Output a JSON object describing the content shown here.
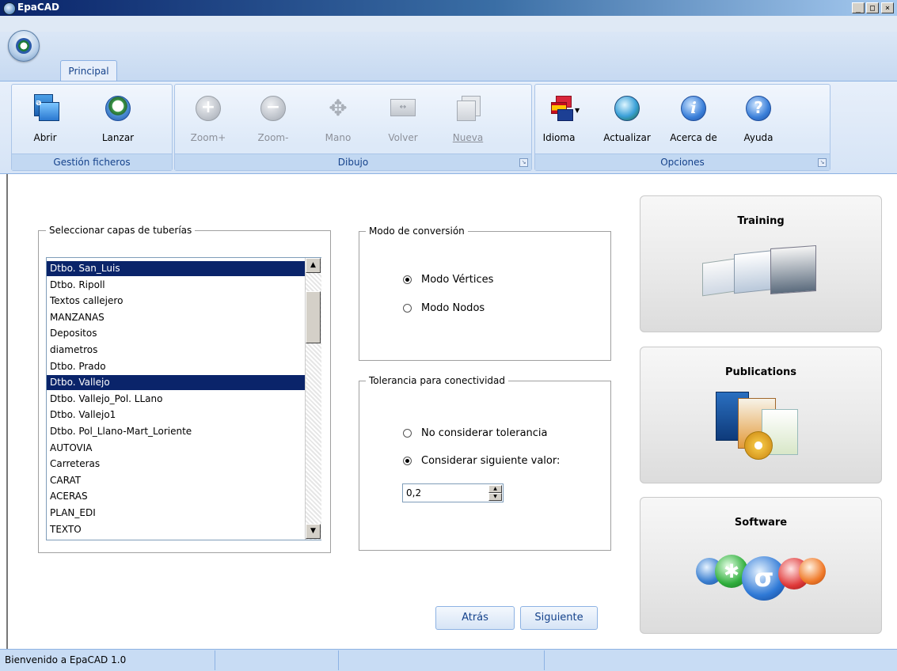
{
  "window": {
    "title": "EpaCAD",
    "min_label": "_",
    "max_label": "□",
    "close_label": "×"
  },
  "ribbon": {
    "tab": "Principal",
    "groups": [
      {
        "label": "Gestión ficheros",
        "tools": [
          {
            "label": "Abrir",
            "icon": "open-folder-icon"
          },
          {
            "label": "Lanzar",
            "icon": "launch-epa-icon"
          }
        ]
      },
      {
        "label": "Dibujo",
        "tools": [
          {
            "label": "Zoom+",
            "icon": "zoom-in-icon"
          },
          {
            "label": "Zoom-",
            "icon": "zoom-out-icon"
          },
          {
            "label": "Mano",
            "icon": "pan-hand-icon"
          },
          {
            "label": "Volver",
            "icon": "restore-view-icon"
          },
          {
            "label": "Nueva",
            "icon": "new-window-icon"
          }
        ]
      },
      {
        "label": "Opciones",
        "tools": [
          {
            "label": "Idioma",
            "icon": "language-flags-icon"
          },
          {
            "label": "Actualizar",
            "icon": "update-globe-icon"
          },
          {
            "label": "Acerca de",
            "icon": "info-icon"
          },
          {
            "label": "Ayuda",
            "icon": "help-icon"
          }
        ]
      }
    ]
  },
  "layers": {
    "legend": "Seleccionar capas  de tuberías",
    "items": [
      {
        "label": "Dtbo. San_Luis",
        "selected": true
      },
      {
        "label": "Dtbo. Ripoll",
        "selected": false
      },
      {
        "label": "Textos callejero",
        "selected": false
      },
      {
        "label": "MANZANAS",
        "selected": false
      },
      {
        "label": "Depositos",
        "selected": false
      },
      {
        "label": "diametros",
        "selected": false
      },
      {
        "label": "Dtbo. Prado",
        "selected": false
      },
      {
        "label": "Dtbo. Vallejo",
        "selected": true
      },
      {
        "label": "Dtbo. Vallejo_Pol. LLano",
        "selected": false
      },
      {
        "label": "Dtbo. Vallejo1",
        "selected": false
      },
      {
        "label": "Dtbo. Pol_Llano-Mart_Loriente",
        "selected": false
      },
      {
        "label": "AUTOVIA",
        "selected": false
      },
      {
        "label": "Carreteras",
        "selected": false
      },
      {
        "label": "CARAT",
        "selected": false
      },
      {
        "label": "ACERAS",
        "selected": false
      },
      {
        "label": "PLAN_EDI",
        "selected": false
      },
      {
        "label": "TEXTO",
        "selected": false
      }
    ]
  },
  "conversion": {
    "legend": "Modo de conversión",
    "option_vertices": "Modo Vértices",
    "option_nodes": "Modo Nodos",
    "selected": "Modo Vértices"
  },
  "tolerance": {
    "legend": "Tolerancia para conectividad",
    "option_none": "No considerar tolerancia",
    "option_value": "Considerar siguiente valor:",
    "selected": "Considerar siguiente valor:",
    "value": "0,2"
  },
  "buttons": {
    "back": "Atrás",
    "next": "Siguiente"
  },
  "cards": [
    {
      "title": "Training"
    },
    {
      "title": "Publications"
    },
    {
      "title": "Software"
    }
  ],
  "status": {
    "message": "Bienvenido a EpaCAD 1.0"
  },
  "colors": {
    "selection": "#0a246a",
    "ribbon_text": "#15428b",
    "title_bar": "#0a246a"
  }
}
